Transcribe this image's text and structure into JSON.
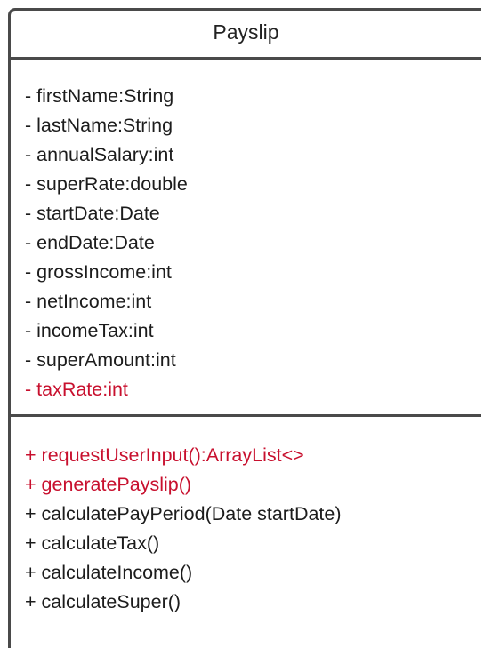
{
  "class_name": "Payslip",
  "colors": {
    "border": "#4a4a4a",
    "text": "#1c1c1c",
    "highlight": "#c8102e"
  },
  "attributes": [
    {
      "text": "- firstName:String",
      "highlight": false
    },
    {
      "text": "- lastName:String",
      "highlight": false
    },
    {
      "text": "- annualSalary:int",
      "highlight": false
    },
    {
      "text": "- superRate:double",
      "highlight": false
    },
    {
      "text": "- startDate:Date",
      "highlight": false
    },
    {
      "text": "- endDate:Date",
      "highlight": false
    },
    {
      "text": "- grossIncome:int",
      "highlight": false
    },
    {
      "text": "- netIncome:int",
      "highlight": false
    },
    {
      "text": "- incomeTax:int",
      "highlight": false
    },
    {
      "text": "- superAmount:int",
      "highlight": false
    },
    {
      "text": "- taxRate:int",
      "highlight": true
    }
  ],
  "operations": [
    {
      "text": "+ requestUserInput():ArrayList<>",
      "highlight": true
    },
    {
      "text": "+ generatePayslip()",
      "highlight": true
    },
    {
      "text": "+ calculatePayPeriod(Date startDate)",
      "highlight": false
    },
    {
      "text": "+ calculateTax()",
      "highlight": false
    },
    {
      "text": "+ calculateIncome()",
      "highlight": false
    },
    {
      "text": "+ calculateSuper()",
      "highlight": false
    }
  ]
}
